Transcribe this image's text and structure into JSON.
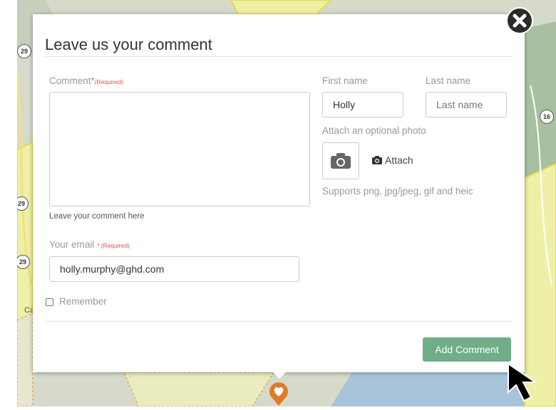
{
  "map": {
    "route_shields": [
      "29",
      "16",
      "29",
      "29"
    ],
    "place_label": "Ca"
  },
  "modal": {
    "title": "Leave us your comment",
    "comment": {
      "label": "Comment*",
      "required": "(Required)",
      "value": "",
      "help": "Leave your comment here"
    },
    "email": {
      "label": "Your email",
      "required": "* (Required)",
      "value": "holly.murphy@ghd.com"
    },
    "remember_label": "Remember",
    "first_name": {
      "label": "First name",
      "value": "Holly"
    },
    "last_name": {
      "label": "Last name",
      "placeholder": "Last name"
    },
    "photo": {
      "label": "Attach an optional photo",
      "attach_label": "Attach",
      "supports": "Supports png, jpg/jpeg, gif and heic"
    },
    "submit_label": "Add Comment"
  },
  "colors": {
    "submit": "#6fae86",
    "marker": "#e07a25",
    "required": "#d9534f"
  }
}
